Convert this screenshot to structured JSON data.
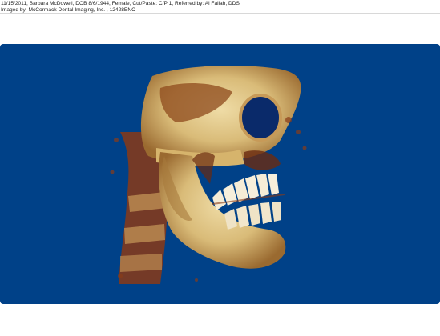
{
  "header": {
    "line1": "11/15/2011, Barbara McDowell, DOB 8/6/1944, Female, Cut/Paste: C/P 1, Referred by:  Al Fallah, DDS",
    "line2": "Imaged by:  McCormack Dental Imaging, Inc. , 12428ENC"
  },
  "viewer": {
    "background_color": "#004188",
    "bone_color": "#e2c98c",
    "shadow_color": "#7a2a10",
    "tooth_color": "#f5ecd6"
  }
}
